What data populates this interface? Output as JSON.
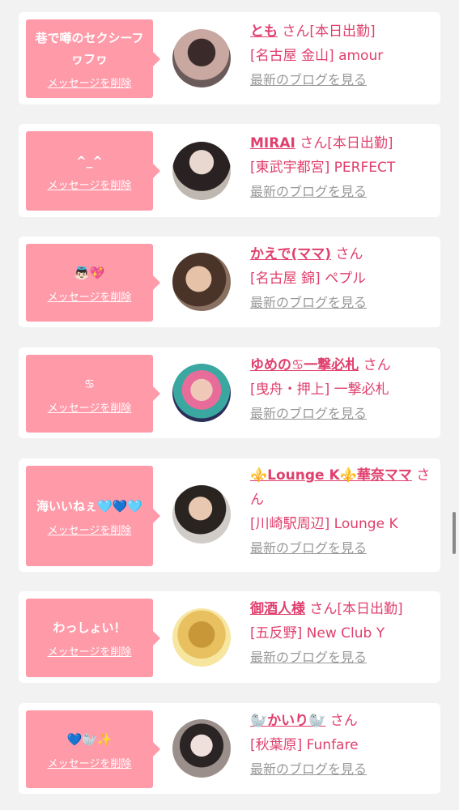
{
  "common": {
    "delete_label": "メッセージを削除",
    "blog_label": "最新のブログを見る",
    "san": "さん"
  },
  "colors": {
    "bubble": "#ff9aa9",
    "accent": "#e0406e",
    "muted": "#999999",
    "background": "#f2f2f2"
  },
  "cards": [
    {
      "message": "巷で噂のセクシーフヮフヮ",
      "name": "とも",
      "status": "[本日出勤]",
      "shop": "[名古屋 金山] amour"
    },
    {
      "message": "^_^",
      "name": "MIRAI",
      "status": "[本日出勤]",
      "shop": "[東武宇都宮] PERFECT"
    },
    {
      "message": "👼🏻💖",
      "name": "かえで(ママ)",
      "status": "",
      "shop": "[名古屋 錦] ペプル"
    },
    {
      "message": "♋",
      "name": "ゆめの♋一撃必札",
      "status": "",
      "shop": "[曳舟・押上] 一撃必札"
    },
    {
      "message": "海いいねぇ🩵💙🩵",
      "name": "⚜️Lounge K⚜️華奈ママ",
      "status": "",
      "shop": "[川崎駅周辺] Lounge K"
    },
    {
      "message": "わっしょい！",
      "name": "御酒人様",
      "status": "[本日出勤]",
      "shop": "[五反野] New Club Y"
    },
    {
      "message": "💙🦭✨",
      "name": "🦭かいり🦭",
      "status": "",
      "shop": "[秋葉原] Funfare"
    }
  ]
}
